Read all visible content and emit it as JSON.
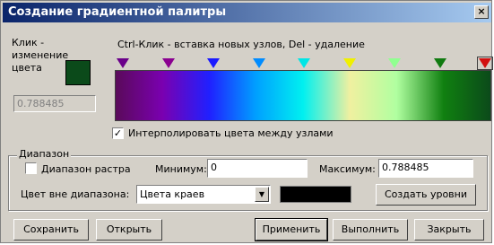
{
  "window": {
    "title": "Создание градиентной палитры",
    "close_label": "×"
  },
  "left": {
    "click_label": "Клик - изменение цвета",
    "value_readout": "0.788485"
  },
  "hint": "Ctrl-Клик - вставка новых узлов, Del - удаление",
  "gradient": {
    "stops": [
      "#5a0a5a",
      "#7a00b0",
      "#2020ff",
      "#00a0ff",
      "#00f0f0",
      "#f0f0a0",
      "#b0ffa0",
      "#108010",
      "#0b4a1a"
    ],
    "markers": [
      {
        "color": "#6a008a",
        "selected": false
      },
      {
        "color": "#8a0090",
        "selected": false
      },
      {
        "color": "#1a1aff",
        "selected": false
      },
      {
        "color": "#008cff",
        "selected": false
      },
      {
        "color": "#00e6e6",
        "selected": false
      },
      {
        "color": "#f0f000",
        "selected": false
      },
      {
        "color": "#90ff90",
        "selected": false
      },
      {
        "color": "#107a10",
        "selected": false
      },
      {
        "color": "#d21010",
        "selected": true
      }
    ]
  },
  "interpolate": {
    "checked": true,
    "mark": "✓",
    "label": "Интерполировать цвета между узлами"
  },
  "range": {
    "group_title": "Диапазон",
    "raster_range": {
      "checked": false,
      "label": "Диапазон растра"
    },
    "min_label": "Минимум:",
    "min_value": "0",
    "max_label": "Максимум:",
    "max_value": "0.788485",
    "out_of_range_label": "Цвет вне диапазона:",
    "out_of_range_value": "Цвета краев",
    "out_of_range_color": "#000000",
    "create_levels_label": "Создать уровни"
  },
  "buttons": {
    "save": "Сохранить",
    "open": "Открыть",
    "apply": "Применить",
    "execute": "Выполнить",
    "close": "Закрыть"
  }
}
